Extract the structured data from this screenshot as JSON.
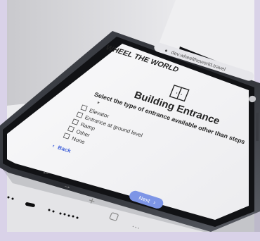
{
  "browser": {
    "url": "dev.wheeltheworld.travel"
  },
  "brand": {
    "logo_text": "WHEEL THE WORLD"
  },
  "page": {
    "title": "Building Entrance",
    "question": "Select the type of entrance available other than steps",
    "required_mark": "*",
    "options": [
      "Elevator",
      "Entrance at ground level",
      "Ramp",
      "Other",
      "None"
    ],
    "back_label": "Back",
    "next_label": "Next",
    "next_arrow": "›"
  },
  "colors": {
    "background": "#d9d2e8",
    "screen": "#f4f4f6",
    "phone_frame": "#2a2c31",
    "accent_blue": "#7d95e6",
    "back_blue": "#3c5ed9"
  },
  "icons": {
    "lock": "lock-icon",
    "reload": "reload-icon",
    "back_nav": "arrow-left-icon",
    "forward_nav": "arrow-right-icon",
    "new_tab": "plus-icon",
    "tabs": "tabs-icon",
    "more": "more-icon",
    "door": "door-icon"
  }
}
